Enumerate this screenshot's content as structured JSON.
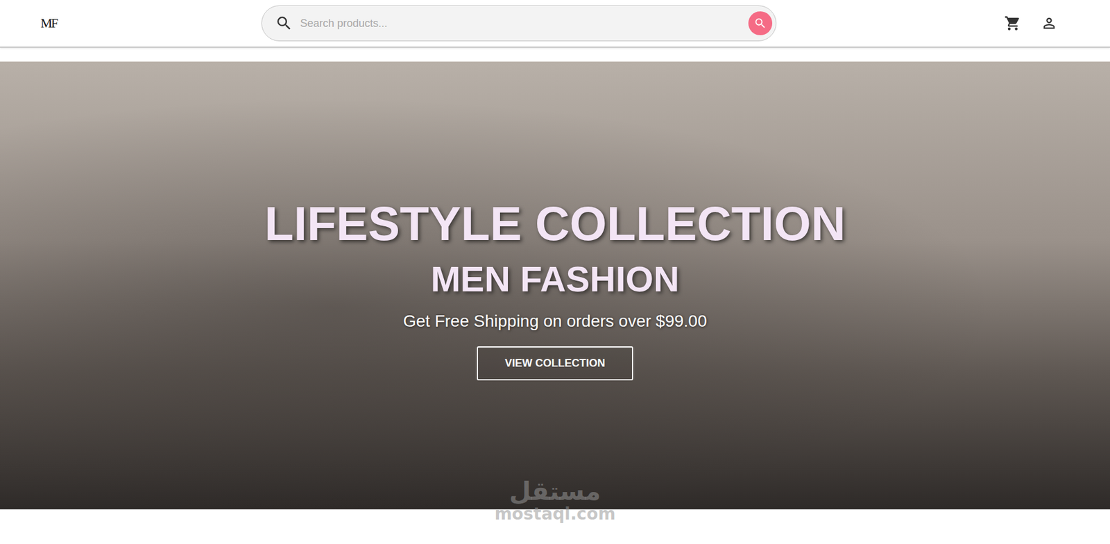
{
  "header": {
    "logo": "MF",
    "search": {
      "placeholder": "Search products..."
    }
  },
  "hero": {
    "title": "LIFESTYLE COLLECTION",
    "subtitle": "MEN FASHION",
    "tagline": "Get Free Shipping on orders over $99.00",
    "button": "VIEW COLLECTION"
  },
  "watermark": {
    "script": "مستقل",
    "site": "mostaql.com"
  }
}
